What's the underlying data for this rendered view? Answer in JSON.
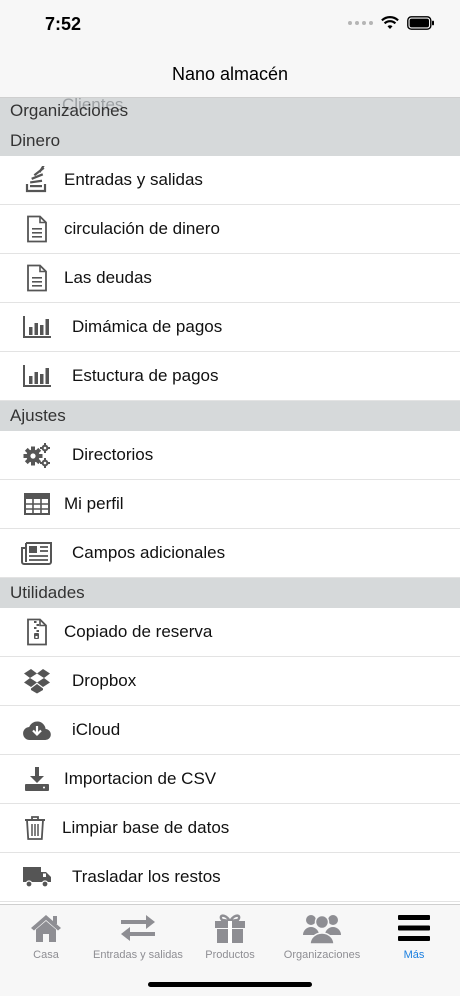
{
  "status_bar": {
    "time": "7:52"
  },
  "nav": {
    "title": "Nano almacén"
  },
  "ghost_header": "Clientes",
  "sections": [
    {
      "title": "Organizaciones"
    },
    {
      "title": "Dinero"
    },
    {
      "title": "Ajustes"
    },
    {
      "title": "Utilidades"
    }
  ],
  "dinero_items": [
    {
      "label": "Entradas y salidas",
      "icon": "stack-icon"
    },
    {
      "label": "circulación de dinero",
      "icon": "document-icon"
    },
    {
      "label": "Las deudas",
      "icon": "document-icon"
    },
    {
      "label": "Dimámica de pagos",
      "icon": "bar-chart-icon"
    },
    {
      "label": "Estuctura de pagos",
      "icon": "bar-chart-icon"
    }
  ],
  "ajustes_items": [
    {
      "label": "Directorios",
      "icon": "gears-icon"
    },
    {
      "label": "Mi perfil",
      "icon": "table-icon"
    },
    {
      "label": "Campos adicionales",
      "icon": "newspaper-icon"
    }
  ],
  "utilidades_items": [
    {
      "label": "Copiado de reserva",
      "icon": "zip-file-icon"
    },
    {
      "label": "Dropbox",
      "icon": "dropbox-icon"
    },
    {
      "label": "iCloud",
      "icon": "cloud-download-icon"
    },
    {
      "label": "Importacion de CSV",
      "icon": "download-icon"
    },
    {
      "label": "Limpiar base de datos",
      "icon": "trash-icon"
    },
    {
      "label": "Trasladar los restos",
      "icon": "truck-icon"
    }
  ],
  "tabs": [
    {
      "label": "Casa",
      "icon": "home-icon"
    },
    {
      "label": "Entradas y salidas",
      "icon": "arrows-exchange-icon"
    },
    {
      "label": "Productos",
      "icon": "gift-icon"
    },
    {
      "label": "Organizaciones",
      "icon": "users-icon"
    },
    {
      "label": "Más",
      "icon": "menu-icon",
      "active": true
    }
  ],
  "colors": {
    "accent": "#1a7fe0",
    "section_bg": "#d6d9da",
    "icon_gray": "#555555",
    "tab_gray": "#8e8e93"
  }
}
